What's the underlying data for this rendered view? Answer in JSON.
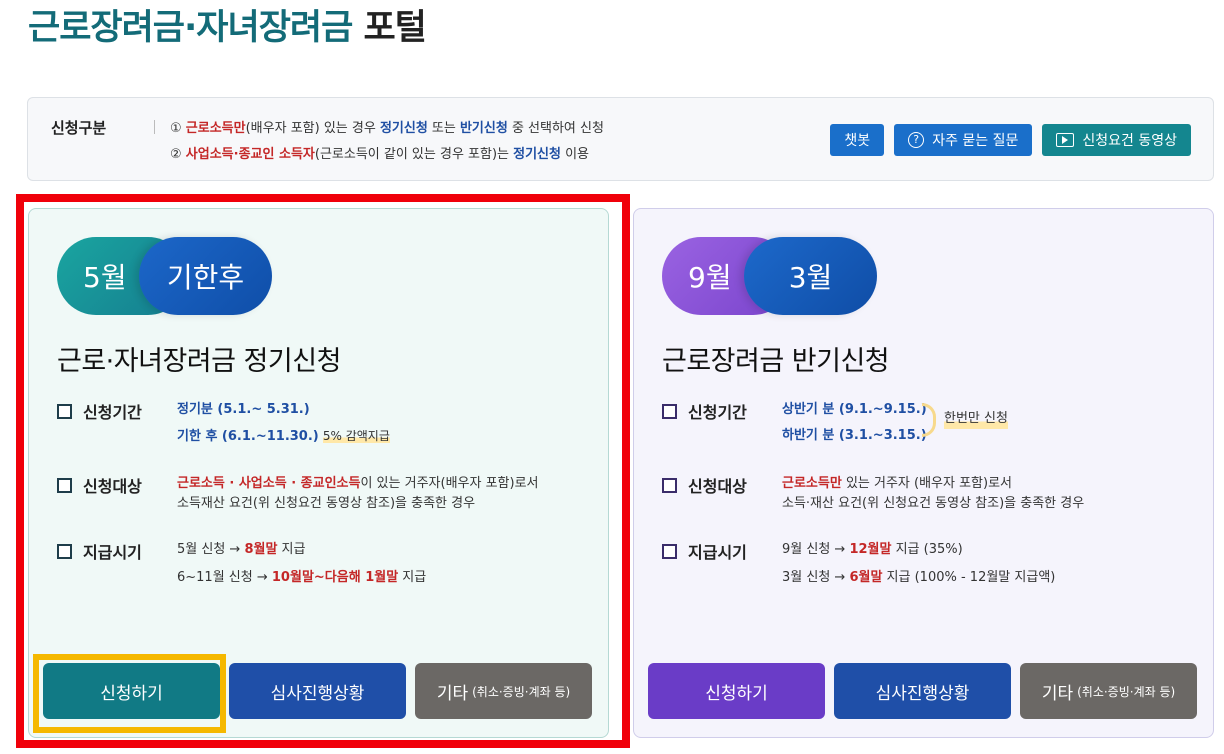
{
  "header": {
    "title_colored": "근로장려금·자녀장려금",
    "title_suffix": "포털"
  },
  "notice": {
    "label": "신청구분",
    "line1": {
      "prefix": "① ",
      "red": "근로소득만",
      "mid1": "(배우자 포함) 있는 경우 ",
      "blue1": "정기신청",
      "mid2": " 또는 ",
      "blue2": "반기신청",
      "suffix": " 중 선택하여 신청"
    },
    "line2": {
      "prefix": "② ",
      "red": "사업소득·종교인 소득자",
      "mid": "(근로소득이 같이 있는 경우 포함)는 ",
      "blue": "정기신청",
      "suffix": " 이용"
    },
    "buttons": {
      "chatbot": "챗봇",
      "faq": "자주 묻는 질문",
      "video": "신청요건 동영상"
    }
  },
  "cards": {
    "regular": {
      "pill_a": "5월",
      "pill_b": "기한후",
      "title": "근로·자녀장려금 정기신청",
      "period_label": "신청기간",
      "period_line1": "정기분 (5.1.~ 5.31.)",
      "period_line2": "기한 후 (6.1.~11.30.)",
      "period_note": "5% 감액지급",
      "target_label": "신청대상",
      "target_red": "근로소득 · 사업소득 · 종교인소득",
      "target_rest": "이 있는 거주자(배우자 포함)로서",
      "target_line2": "소득재산 요건(위 신청요건 동영상 참조)을 충족한 경우",
      "pay_label": "지급시기",
      "pay1_pre": "5월 신청 → ",
      "pay1_red": "8월말",
      "pay1_post": " 지급",
      "pay2_pre": "6~11월 신청 → ",
      "pay2_red": "10월말~다음해 1월말",
      "pay2_post": " 지급",
      "btn_apply": "신청하기",
      "btn_status": "심사진행상황",
      "btn_etc": "기타",
      "btn_etc_small": "(취소·증빙·계좌 등)"
    },
    "half": {
      "pill_a": "9월",
      "pill_b": "3월",
      "title": "근로장려금 반기신청",
      "period_label": "신청기간",
      "period_line1": "상반기 분 (9.1.~9.15.)",
      "period_line2": "하반기 분 (3.1.~3.15.)",
      "once_note": "한번만 신청",
      "target_label": "신청대상",
      "target_red": "근로소득만",
      "target_rest": " 있는 거주자 (배우자 포함)로서",
      "target_line2": "소득·재산 요건(위 신청요건 동영상 참조)을 충족한 경우",
      "pay_label": "지급시기",
      "pay1_pre": "9월 신청 → ",
      "pay1_red": "12월말",
      "pay1_post": " 지급 (35%)",
      "pay2_pre": "3월 신청 → ",
      "pay2_red": "6월말",
      "pay2_post": " 지급 (100% - 12월말 지급액)",
      "btn_apply": "신청하기",
      "btn_status": "심사진행상황",
      "btn_etc": "기타",
      "btn_etc_small": "(취소·증빙·계좌 등)"
    }
  },
  "colors": {
    "highlight_red": "#f0000a",
    "highlight_yellow": "#f5b800",
    "title_teal": "#136b78"
  }
}
